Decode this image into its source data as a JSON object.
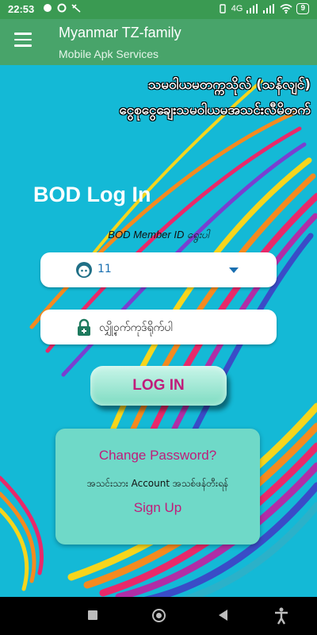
{
  "status_bar": {
    "time": "22:53",
    "network": "4G",
    "battery": "9"
  },
  "app_bar": {
    "title": "Myanmar TZ-family",
    "subtitle": "Mobile Apk Services"
  },
  "header": {
    "line1": "သမဝါယမတက္ကသိုလ် (သန်လျင်)",
    "line2": "ငွေစုငွေချေးသမဝါယမအသင်းလီမိတက်"
  },
  "login": {
    "title": "BOD Log In",
    "member_label": "BOD Member ID ရွေးပါ",
    "selected_member": "11",
    "password_placeholder": "လျှို့ဝှက်ကုဒ်ရိုက်ပါ",
    "button_label": "LOG IN"
  },
  "account": {
    "change_password": "Change Password?",
    "no_account_text": "အသင်းသား Account အသစ်ဖန်တီးရန်",
    "sign_up": "Sign Up"
  },
  "colors": {
    "status_bar": "#3a9a52",
    "app_bar": "#48a46a",
    "background": "#14b9d6",
    "accent_pink": "#c01c7a",
    "card": "#6fd9c8"
  },
  "icons": {
    "menu": "hamburger-menu-icon",
    "member": "face-icon",
    "dropdown": "dropdown-arrow-icon",
    "password": "lock-icon"
  }
}
